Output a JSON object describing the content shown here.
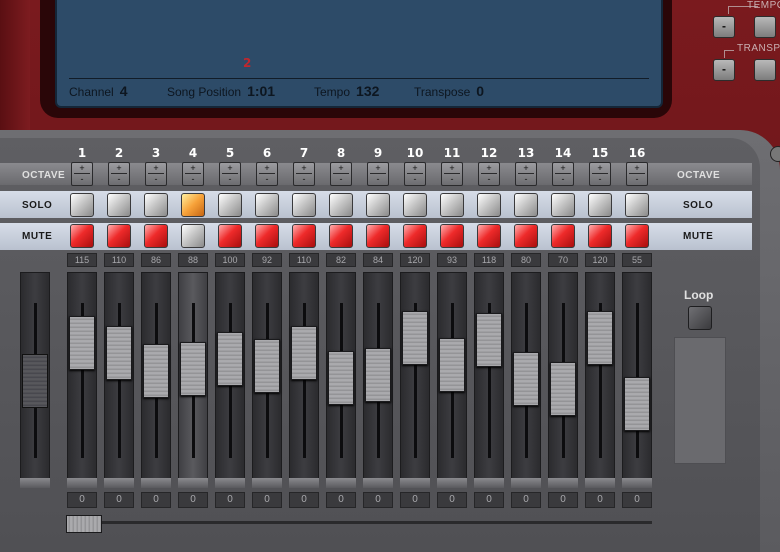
{
  "lcd": {
    "marker": "2",
    "channel_label": "Channel",
    "channel_value": "4",
    "song_position_label": "Song Position",
    "song_position_value": "1:01",
    "tempo_label": "Tempo",
    "tempo_value": "132",
    "transpose_label": "Transpose",
    "transpose_value": "0"
  },
  "top_controls": {
    "tempo_label": "TEMPO",
    "transpose_label": "TRANSPO",
    "minus": "-"
  },
  "rows": {
    "octave": "OCTAVE",
    "solo": "SOLO",
    "mute": "MUTE"
  },
  "octave_plus": "+",
  "octave_minus": "-",
  "channels": [
    {
      "num": "1",
      "velocity": "115",
      "pan": "0",
      "solo": false,
      "mute": true,
      "fader": 0.88
    },
    {
      "num": "2",
      "velocity": "110",
      "pan": "0",
      "solo": false,
      "mute": true,
      "fader": 0.8
    },
    {
      "num": "3",
      "velocity": "86",
      "pan": "0",
      "solo": false,
      "mute": true,
      "fader": 0.65
    },
    {
      "num": "4",
      "velocity": "88",
      "pan": "0",
      "solo": true,
      "mute": false,
      "fader": 0.67
    },
    {
      "num": "5",
      "velocity": "100",
      "pan": "0",
      "solo": false,
      "mute": true,
      "fader": 0.75
    },
    {
      "num": "6",
      "velocity": "92",
      "pan": "0",
      "solo": false,
      "mute": true,
      "fader": 0.69
    },
    {
      "num": "7",
      "velocity": "110",
      "pan": "0",
      "solo": false,
      "mute": true,
      "fader": 0.8
    },
    {
      "num": "8",
      "velocity": "82",
      "pan": "0",
      "solo": false,
      "mute": true,
      "fader": 0.6
    },
    {
      "num": "9",
      "velocity": "84",
      "pan": "0",
      "solo": false,
      "mute": true,
      "fader": 0.62
    },
    {
      "num": "10",
      "velocity": "120",
      "pan": "0",
      "solo": false,
      "mute": true,
      "fader": 0.92
    },
    {
      "num": "11",
      "velocity": "93",
      "pan": "0",
      "solo": false,
      "mute": true,
      "fader": 0.7
    },
    {
      "num": "12",
      "velocity": "118",
      "pan": "0",
      "solo": false,
      "mute": true,
      "fader": 0.9
    },
    {
      "num": "13",
      "velocity": "80",
      "pan": "0",
      "solo": false,
      "mute": true,
      "fader": 0.59
    },
    {
      "num": "14",
      "velocity": "70",
      "pan": "0",
      "solo": false,
      "mute": true,
      "fader": 0.51
    },
    {
      "num": "15",
      "velocity": "120",
      "pan": "0",
      "solo": false,
      "mute": true,
      "fader": 0.92
    },
    {
      "num": "16",
      "velocity": "55",
      "pan": "0",
      "solo": false,
      "mute": true,
      "fader": 0.39
    }
  ],
  "master_fader": 0.57,
  "loop": {
    "label": "Loop"
  },
  "colors": {
    "mute_on": "#ee2a2a",
    "solo_on": "#f7a23a",
    "lcd": "#2d4b68",
    "frame": "#6a1519"
  }
}
